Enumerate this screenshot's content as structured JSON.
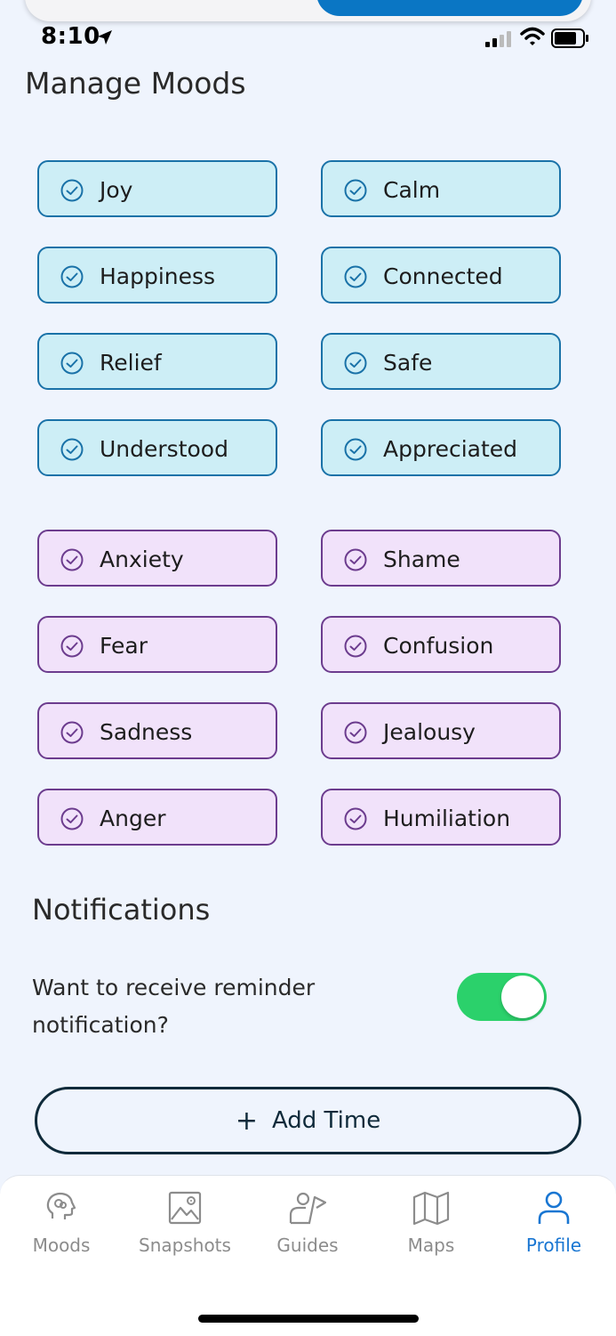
{
  "status_bar": {
    "time": "8:10"
  },
  "page": {
    "title": "Manage Moods"
  },
  "moods": {
    "positive": [
      "Joy",
      "Calm",
      "Happiness",
      "Connected",
      "Relief",
      "Safe",
      "Understood",
      "Appreciated"
    ],
    "negative": [
      "Anxiety",
      "Shame",
      "Fear",
      "Confusion",
      "Sadness",
      "Jealousy",
      "Anger",
      "Humiliation"
    ]
  },
  "notifications": {
    "title": "Notifications",
    "question": "Want to receive reminder notification?",
    "toggle_on": true,
    "add_time_label": "Add Time"
  },
  "tabs": [
    {
      "label": "Moods",
      "icon": "head-icon"
    },
    {
      "label": "Snapshots",
      "icon": "image-icon"
    },
    {
      "label": "Guides",
      "icon": "guide-icon"
    },
    {
      "label": "Maps",
      "icon": "map-icon"
    },
    {
      "label": "Profile",
      "icon": "person-icon"
    }
  ],
  "active_tab": "Profile",
  "colors": {
    "positive_fill": "#cdeef6",
    "positive_border": "#1a72a8",
    "negative_fill": "#f1e2fa",
    "negative_border": "#6c3c8e",
    "toggle": "#2bd16b",
    "active_tab": "#1976d2"
  }
}
